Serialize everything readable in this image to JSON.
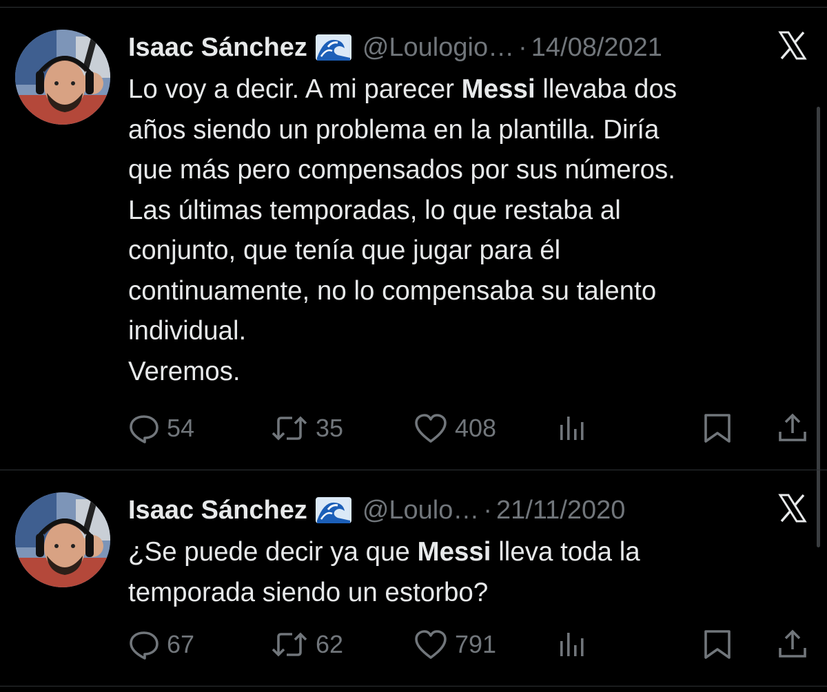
{
  "colors": {
    "background": "#000000",
    "text": "#e7e9ea",
    "muted": "#71767b",
    "divider": "#2f3336"
  },
  "tweets": [
    {
      "author": "Isaac Sánchez",
      "emoji": "wave-emoji",
      "handle": "@Loulogio…",
      "separator": "·",
      "date": "14/08/2021",
      "platform_icon": "x-logo-icon",
      "text_lines": [
        [
          "Lo voy a decir. A mi parecer ",
          "Messi",
          " llevaba dos"
        ],
        [
          "años siendo un problema en la plantilla. Diría"
        ],
        [
          "que más pero compensados por sus números."
        ],
        [
          "Las últimas temporadas, lo que restaba al"
        ],
        [
          "conjunto, que tenía que jugar para él"
        ],
        [
          "continuamente, no lo compensaba su talento"
        ],
        [
          "individual."
        ],
        [
          "Veremos."
        ]
      ],
      "replies": "54",
      "retweets": "35",
      "likes": "408"
    },
    {
      "author": "Isaac Sánchez",
      "emoji": "wave-emoji",
      "handle": "@Loulo…",
      "separator": "·",
      "date": "21/11/2020",
      "platform_icon": "x-logo-icon",
      "text_lines": [
        [
          "¿Se puede decir ya que ",
          "Messi",
          " lleva toda la"
        ],
        [
          "temporada siendo un estorbo?"
        ]
      ],
      "replies": "67",
      "retweets": "62",
      "likes": "791"
    }
  ]
}
